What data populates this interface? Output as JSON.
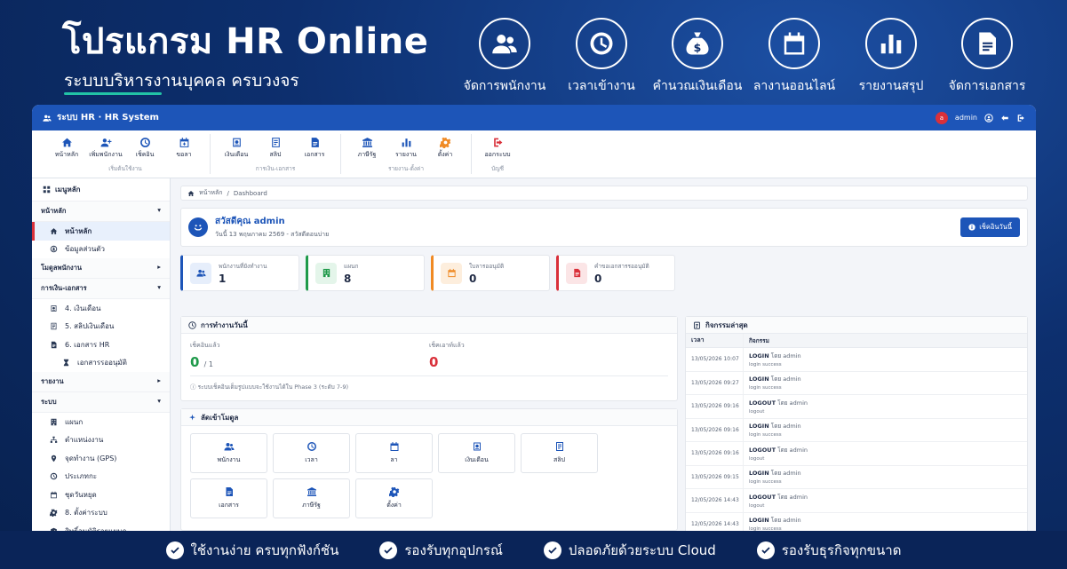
{
  "hero": {
    "title": "โปรแกรม HR Online",
    "subtitle": "ระบบบริหารงานบุคคล ครบวงจร",
    "features": [
      {
        "label": "จัดการพนักงาน",
        "icon": "users-icon"
      },
      {
        "label": "เวลาเข้างาน",
        "icon": "clock-icon"
      },
      {
        "label": "คำนวณเงินเดือน",
        "icon": "money-bag-icon"
      },
      {
        "label": "ลางานออนไลน์",
        "icon": "calendar-icon"
      },
      {
        "label": "รายงานสรุป",
        "icon": "bar-chart-icon"
      },
      {
        "label": "จัดการเอกสาร",
        "icon": "document-icon"
      }
    ]
  },
  "window": {
    "title": "ระบบ HR · HR System",
    "user_initial": "a",
    "user_name": "admin"
  },
  "ribbon": {
    "groups": [
      {
        "label": "เริ่มต้นใช้งาน",
        "buttons": [
          {
            "label": "หน้าหลัก",
            "icon": "home-icon"
          },
          {
            "label": "เพิ่มพนักงาน",
            "icon": "user-plus-icon"
          },
          {
            "label": "เช็คอิน",
            "icon": "clock-icon"
          },
          {
            "label": "ขอลา",
            "icon": "calendar-plus-icon"
          }
        ]
      },
      {
        "label": "การเงิน-เอกสาร",
        "buttons": [
          {
            "label": "เงินเดือน",
            "icon": "payroll-icon"
          },
          {
            "label": "สลิป",
            "icon": "slip-icon"
          },
          {
            "label": "เอกสาร",
            "icon": "document-icon"
          }
        ]
      },
      {
        "label": "รายงาน-ตั้งค่า",
        "buttons": [
          {
            "label": "ภาษีรัฐ",
            "icon": "government-icon"
          },
          {
            "label": "รายงาน",
            "icon": "bar-chart-icon"
          },
          {
            "label": "ตั้งค่า",
            "icon": "gear-icon"
          }
        ]
      },
      {
        "label": "บัญชี",
        "buttons": [
          {
            "label": "ออกระบบ",
            "icon": "logout-icon"
          }
        ]
      }
    ]
  },
  "sidebar": {
    "header": "เมนูหลัก",
    "sections": [
      {
        "label": "หน้าหลัก",
        "items": [
          {
            "label": "หน้าหลัก",
            "icon": "home-icon",
            "active": true
          },
          {
            "label": "ข้อมูลส่วนตัว",
            "icon": "user-circle-icon"
          }
        ]
      },
      {
        "label": "โมดูลพนักงาน",
        "items": []
      },
      {
        "label": "การเงิน-เอกสาร",
        "items": [
          {
            "label": "4. เงินเดือน",
            "icon": "payroll-icon"
          },
          {
            "label": "5. สลิปเงินเดือน",
            "icon": "slip-icon"
          },
          {
            "label": "6. เอกสาร HR",
            "icon": "document-icon"
          },
          {
            "label": "เอกสารรออนุมัติ",
            "icon": "hourglass-icon",
            "sub": true
          }
        ]
      },
      {
        "label": "รายงาน",
        "items": []
      },
      {
        "label": "ระบบ",
        "items": [
          {
            "label": "แผนก",
            "icon": "building-icon"
          },
          {
            "label": "ตำแหน่งงาน",
            "icon": "sitemap-icon"
          },
          {
            "label": "จุดทำงาน (GPS)",
            "icon": "map-pin-icon"
          },
          {
            "label": "ประเภทกะ",
            "icon": "clock-icon"
          },
          {
            "label": "ชุดวันหยุด",
            "icon": "calendar-icon"
          },
          {
            "label": "8. ตั้งค่าระบบ",
            "icon": "gear-icon"
          },
          {
            "label": "สิทธิ์อนุมัติรายแผนก",
            "icon": "shield-icon"
          }
        ]
      }
    ]
  },
  "breadcrumb": {
    "home": "หน้าหลัก",
    "sep": "/",
    "current": "Dashboard"
  },
  "welcome": {
    "title": "สวัสดีคุณ admin",
    "subtitle": "วันนี้ 13 พฤษภาคม 2569 - สวัสดีตอนบ่าย",
    "checkin_label": "เช็คอินวันนี้"
  },
  "stats": [
    {
      "label": "พนักงานที่ยังทำงาน",
      "value": "1",
      "icon": "users-icon",
      "color": "#1d55b8",
      "bg": "#e6eefb"
    },
    {
      "label": "แผนก",
      "value": "8",
      "icon": "building-icon",
      "color": "#1f9a4a",
      "bg": "#e4f5ea"
    },
    {
      "label": "ใบลารออนุมัติ",
      "value": "0",
      "icon": "calendar-icon",
      "color": "#f08a24",
      "bg": "#fdeedd"
    },
    {
      "label": "คำขอเอกสารรออนุมัติ",
      "value": "0",
      "icon": "document-icon",
      "color": "#d9303a",
      "bg": "#fbe5e6"
    }
  ],
  "attendance": {
    "title": "การทำงานวันนี้",
    "checked_in_label": "เช็คอินแล้ว",
    "checked_in_value": "0",
    "checked_in_total": "/ 1",
    "checked_out_label": "เช็คเอาท์แล้ว",
    "checked_out_value": "0",
    "note": "ระบบเช็คอินเต็มรูปแบบจะใช้งานได้ใน Phase 3 (ระดับ 7-9)"
  },
  "quick": {
    "title": "ลัดเข้าโมดูล",
    "buttons": [
      {
        "label": "พนักงาน",
        "icon": "users-icon"
      },
      {
        "label": "เวลา",
        "icon": "clock-icon"
      },
      {
        "label": "ลา",
        "icon": "calendar-icon"
      },
      {
        "label": "เงินเดือน",
        "icon": "payroll-icon"
      },
      {
        "label": "สลิป",
        "icon": "slip-icon"
      },
      {
        "label": "เอกสาร",
        "icon": "document-icon"
      },
      {
        "label": "ภาษีรัฐ",
        "icon": "government-icon"
      },
      {
        "label": "ตั้งค่า",
        "icon": "gear-icon"
      }
    ]
  },
  "activity": {
    "title": "กิจกรรมล่าสุด",
    "col_time": "เวลา",
    "col_activity": "กิจกรรม",
    "by_prefix": "โดย",
    "rows": [
      {
        "time": "13/05/2026 10:07",
        "action": "LOGIN",
        "user": "admin",
        "desc": "login success"
      },
      {
        "time": "13/05/2026 09:27",
        "action": "LOGIN",
        "user": "admin",
        "desc": "login success"
      },
      {
        "time": "13/05/2026 09:16",
        "action": "LOGOUT",
        "user": "admin",
        "desc": "logout"
      },
      {
        "time": "13/05/2026 09:16",
        "action": "LOGIN",
        "user": "admin",
        "desc": "login success"
      },
      {
        "time": "13/05/2026 09:16",
        "action": "LOGOUT",
        "user": "admin",
        "desc": "logout"
      },
      {
        "time": "13/05/2026 09:15",
        "action": "LOGIN",
        "user": "admin",
        "desc": "login success"
      },
      {
        "time": "12/05/2026 14:43",
        "action": "LOGOUT",
        "user": "admin",
        "desc": "logout"
      },
      {
        "time": "12/05/2026 14:43",
        "action": "LOGIN",
        "user": "admin",
        "desc": "login success"
      }
    ]
  },
  "footer": [
    "ใช้งานง่าย ครบทุกฟังก์ชัน",
    "รองรับทุกอุปกรณ์",
    "ปลอดภัยด้วยระบบ Cloud",
    "รองรับธุรกิจทุกขนาด"
  ]
}
